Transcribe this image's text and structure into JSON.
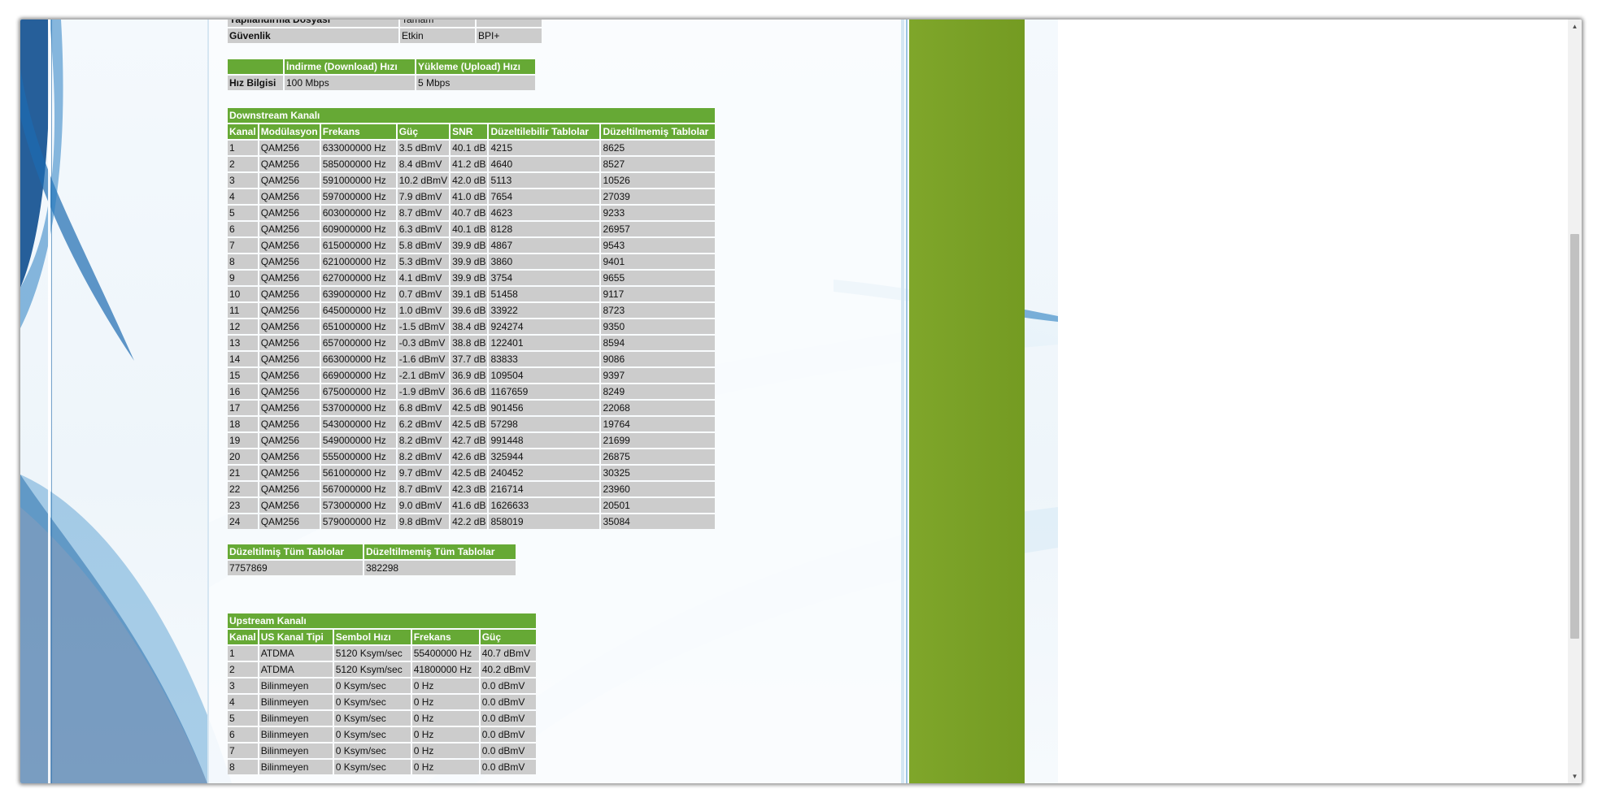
{
  "security_table": {
    "partial_row": {
      "label": "Yapılandırma Dosyası",
      "value": "Tamam"
    },
    "row": {
      "label": "Güvenlik",
      "value1": "Etkin",
      "value2": "BPI+"
    }
  },
  "speed_table": {
    "headers": [
      "İndirme (Download) Hızı",
      "Yükleme (Upload) Hızı"
    ],
    "label": "Hız Bilgisi",
    "download": "100 Mbps",
    "upload": "5 Mbps"
  },
  "downstream": {
    "title": "Downstream Kanalı",
    "headers": [
      "Kanal",
      "Modülasyon",
      "Frekans",
      "Güç",
      "SNR",
      "Düzeltilebilir Tablolar",
      "Düzeltilmemiş Tablolar"
    ],
    "rows": [
      [
        "1",
        "QAM256",
        "633000000 Hz",
        "3.5 dBmV",
        "40.1 dB",
        "4215",
        "8625"
      ],
      [
        "2",
        "QAM256",
        "585000000 Hz",
        "8.4 dBmV",
        "41.2 dB",
        "4640",
        "8527"
      ],
      [
        "3",
        "QAM256",
        "591000000 Hz",
        "10.2 dBmV",
        "42.0 dB",
        "5113",
        "10526"
      ],
      [
        "4",
        "QAM256",
        "597000000 Hz",
        "7.9 dBmV",
        "41.0 dB",
        "7654",
        "27039"
      ],
      [
        "5",
        "QAM256",
        "603000000 Hz",
        "8.7 dBmV",
        "40.7 dB",
        "4623",
        "9233"
      ],
      [
        "6",
        "QAM256",
        "609000000 Hz",
        "6.3 dBmV",
        "40.1 dB",
        "8128",
        "26957"
      ],
      [
        "7",
        "QAM256",
        "615000000 Hz",
        "5.8 dBmV",
        "39.9 dB",
        "4867",
        "9543"
      ],
      [
        "8",
        "QAM256",
        "621000000 Hz",
        "5.3 dBmV",
        "39.9 dB",
        "3860",
        "9401"
      ],
      [
        "9",
        "QAM256",
        "627000000 Hz",
        "4.1 dBmV",
        "39.9 dB",
        "3754",
        "9655"
      ],
      [
        "10",
        "QAM256",
        "639000000 Hz",
        "0.7 dBmV",
        "39.1 dB",
        "51458",
        "9117"
      ],
      [
        "11",
        "QAM256",
        "645000000 Hz",
        "1.0 dBmV",
        "39.6 dB",
        "33922",
        "8723"
      ],
      [
        "12",
        "QAM256",
        "651000000 Hz",
        "-1.5 dBmV",
        "38.4 dB",
        "924274",
        "9350"
      ],
      [
        "13",
        "QAM256",
        "657000000 Hz",
        "-0.3 dBmV",
        "38.8 dB",
        "122401",
        "8594"
      ],
      [
        "14",
        "QAM256",
        "663000000 Hz",
        "-1.6 dBmV",
        "37.7 dB",
        "83833",
        "9086"
      ],
      [
        "15",
        "QAM256",
        "669000000 Hz",
        "-2.1 dBmV",
        "36.9 dB",
        "109504",
        "9397"
      ],
      [
        "16",
        "QAM256",
        "675000000 Hz",
        "-1.9 dBmV",
        "36.6 dB",
        "1167659",
        "8249"
      ],
      [
        "17",
        "QAM256",
        "537000000 Hz",
        "6.8 dBmV",
        "42.5 dB",
        "901456",
        "22068"
      ],
      [
        "18",
        "QAM256",
        "543000000 Hz",
        "6.2 dBmV",
        "42.5 dB",
        "57298",
        "19764"
      ],
      [
        "19",
        "QAM256",
        "549000000 Hz",
        "8.2 dBmV",
        "42.7 dB",
        "991448",
        "21699"
      ],
      [
        "20",
        "QAM256",
        "555000000 Hz",
        "8.2 dBmV",
        "42.6 dB",
        "325944",
        "26875"
      ],
      [
        "21",
        "QAM256",
        "561000000 Hz",
        "9.7 dBmV",
        "42.5 dB",
        "240452",
        "30325"
      ],
      [
        "22",
        "QAM256",
        "567000000 Hz",
        "8.7 dBmV",
        "42.3 dB",
        "216714",
        "23960"
      ],
      [
        "23",
        "QAM256",
        "573000000 Hz",
        "9.0 dBmV",
        "41.6 dB",
        "1626633",
        "20501"
      ],
      [
        "24",
        "QAM256",
        "579000000 Hz",
        "9.8 dBmV",
        "42.2 dB",
        "858019",
        "35084"
      ]
    ]
  },
  "totals": {
    "headers": [
      "Düzeltilmiş Tüm Tablolar",
      "Düzeltilmemiş Tüm Tablolar"
    ],
    "values": [
      "7757869",
      "382298"
    ]
  },
  "upstream": {
    "title": "Upstream Kanalı",
    "headers": [
      "Kanal",
      "US Kanal Tipi",
      "Sembol Hızı",
      "Frekans",
      "Güç"
    ],
    "rows": [
      [
        "1",
        "ATDMA",
        "5120 Ksym/sec",
        "55400000 Hz",
        "40.7 dBmV"
      ],
      [
        "2",
        "ATDMA",
        "5120 Ksym/sec",
        "41800000 Hz",
        "40.2 dBmV"
      ],
      [
        "3",
        "Bilinmeyen",
        "0 Ksym/sec",
        "0 Hz",
        "0.0 dBmV"
      ],
      [
        "4",
        "Bilinmeyen",
        "0 Ksym/sec",
        "0 Hz",
        "0.0 dBmV"
      ],
      [
        "5",
        "Bilinmeyen",
        "0 Ksym/sec",
        "0 Hz",
        "0.0 dBmV"
      ],
      [
        "6",
        "Bilinmeyen",
        "0 Ksym/sec",
        "0 Hz",
        "0.0 dBmV"
      ],
      [
        "7",
        "Bilinmeyen",
        "0 Ksym/sec",
        "0 Hz",
        "0.0 dBmV"
      ],
      [
        "8",
        "Bilinmeyen",
        "0 Ksym/sec",
        "0 Hz",
        "0.0 dBmV"
      ]
    ]
  },
  "colors": {
    "table_header": "#66a935",
    "table_cell": "#cccccc",
    "green_column": "#7aa127",
    "scroll_thumb": "#c1c1c1"
  },
  "icons": {
    "scroll_up": "scroll-up-arrow-icon",
    "scroll_down": "scroll-down-arrow-icon"
  }
}
